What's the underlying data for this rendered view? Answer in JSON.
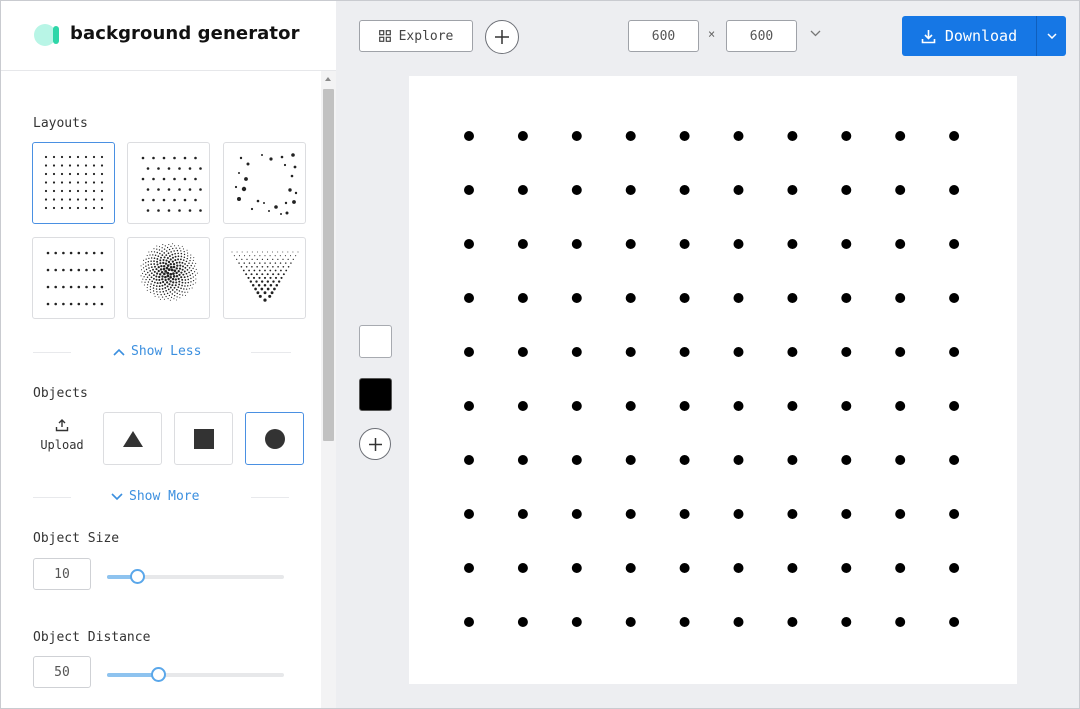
{
  "app": {
    "title": "background generator",
    "colors": {
      "accent": "#1677e5",
      "link": "#3b8fdf",
      "brand_light": "#b8f5e6",
      "brand_dark": "#2ed6a8"
    }
  },
  "sidebar": {
    "layouts_label": "Layouts",
    "layouts": [
      {
        "name": "grid",
        "selected": true
      },
      {
        "name": "offset-grid",
        "selected": false
      },
      {
        "name": "random",
        "selected": false
      },
      {
        "name": "rows",
        "selected": false
      },
      {
        "name": "spiral",
        "selected": false
      },
      {
        "name": "triangle",
        "selected": false
      }
    ],
    "show_less_label": "Show Less",
    "objects_label": "Objects",
    "upload_label": "Upload",
    "objects": [
      {
        "name": "triangle",
        "selected": false
      },
      {
        "name": "square",
        "selected": false
      },
      {
        "name": "circle",
        "selected": true
      }
    ],
    "show_more_label": "Show More",
    "object_size": {
      "label": "Object Size",
      "value": "10",
      "fraction": 0.17
    },
    "object_distance": {
      "label": "Object Distance",
      "value": "50",
      "fraction": 0.29
    }
  },
  "toolbar": {
    "explore_label": "Explore",
    "width": "600",
    "height": "600",
    "times": "×",
    "download_label": "Download"
  },
  "palette": {
    "colors": [
      "#ffffff",
      "#000000"
    ]
  },
  "canvas": {
    "background": "#ffffff",
    "object_color": "#000000",
    "object_shape": "circle",
    "rows": 10,
    "cols": 10
  }
}
